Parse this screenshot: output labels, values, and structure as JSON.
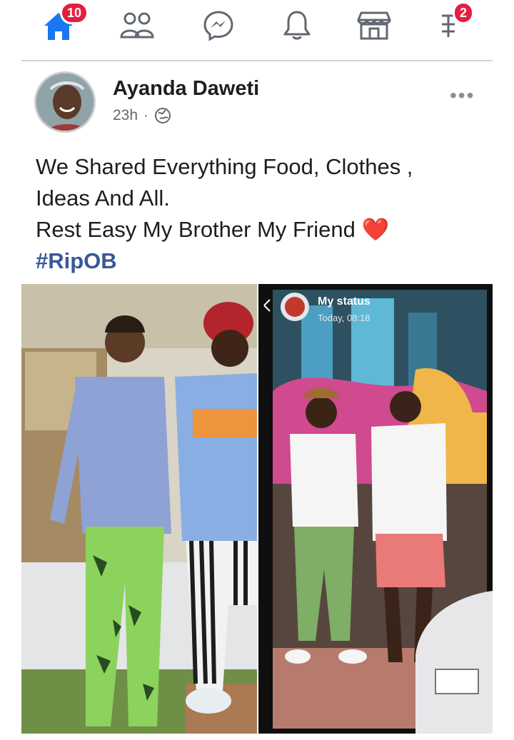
{
  "nav": {
    "home_badge": "10",
    "notifications_badge": "2",
    "items": [
      "home-icon",
      "friends-icon",
      "messenger-icon",
      "bell-icon",
      "marketplace-icon",
      "menu-icon"
    ]
  },
  "post": {
    "author": "Ayanda Daweti",
    "time": "23h",
    "separator": "·",
    "more": "•••",
    "text_lines": [
      "We Shared Everything Food, Clothes ,",
      "Ideas And All.",
      "Rest Easy My Brother My Friend"
    ],
    "heart": "❤️",
    "hashtag": "#RipOB"
  },
  "status": {
    "label": "My status",
    "time": "Today, 08:18"
  },
  "colors": {
    "accent": "#1877f2",
    "badge": "#e41e3f",
    "hashtag": "#385898"
  }
}
